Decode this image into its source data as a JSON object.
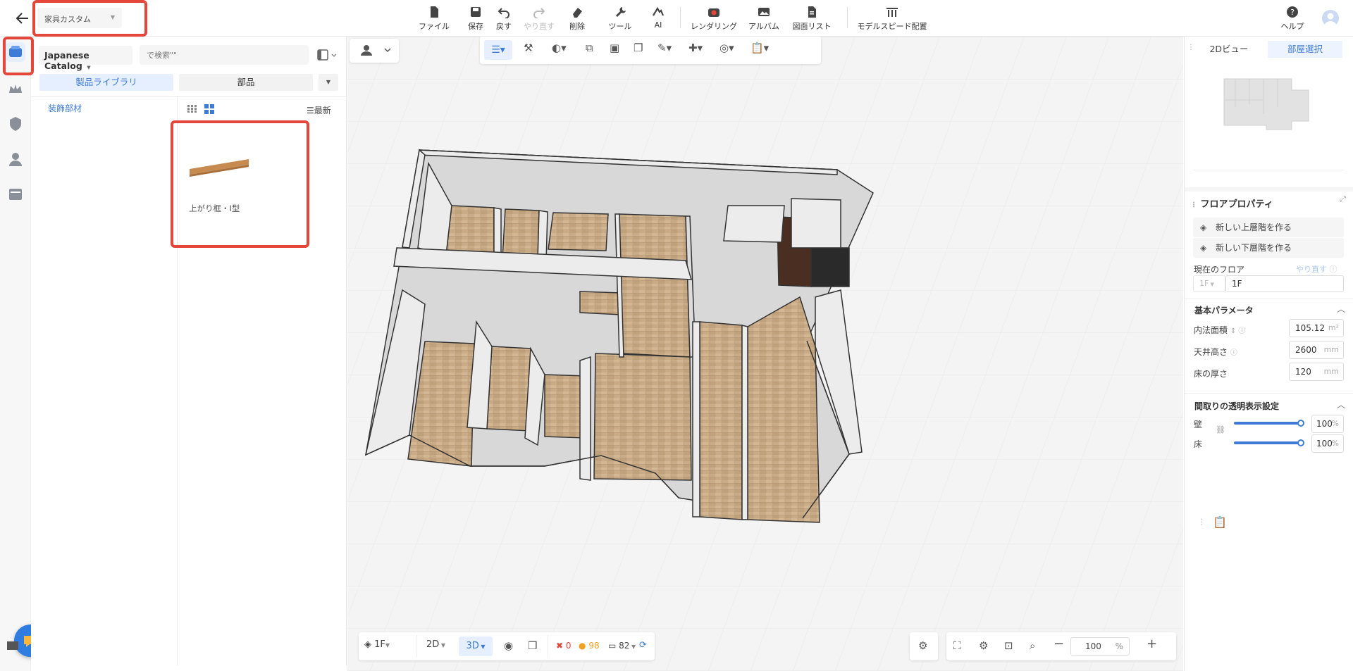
{
  "header": {
    "title_dropdown": "家具カスタム",
    "tools": [
      {
        "label": "ファイル",
        "icon": "file-icon"
      },
      {
        "label": "保存",
        "icon": "save-icon"
      },
      {
        "label": "戻す",
        "icon": "undo-icon"
      },
      {
        "label": "やり直す",
        "icon": "redo-icon"
      },
      {
        "label": "削除",
        "icon": "eraser-icon"
      },
      {
        "label": "ツール",
        "icon": "wrench-icon"
      },
      {
        "label": "AI",
        "icon": "ai-icon"
      },
      {
        "label": "レンダリング",
        "icon": "camera-icon"
      },
      {
        "label": "アルバム",
        "icon": "album-icon"
      },
      {
        "label": "図面リスト",
        "icon": "drawing-list-icon"
      },
      {
        "label": "モデルスピード配置",
        "icon": "model-speed-icon"
      }
    ],
    "help_label": "ヘルプ"
  },
  "left_panel": {
    "catalog": "Japanese Catalog",
    "search_placeholder": "で検索\"\"",
    "tab_library": "製品ライブラリ",
    "tab_parts": "部品",
    "category": "装飾部材",
    "sort_label": "最新",
    "products": [
      {
        "name": "上がり框・I型"
      }
    ]
  },
  "viewport": {
    "floor_selector": "1F",
    "mode_2d": "2D",
    "mode_3d": "3D",
    "errors": "0",
    "warnings": "98",
    "items": "82",
    "zoom": "100",
    "zoom_unit": "%"
  },
  "right_panel": {
    "tab_2d": "2Dビュー",
    "tab_room": "部屋選択",
    "floor_props_title": "フロアプロパティ",
    "btn_new_upper": "新しい上層階を作る",
    "btn_new_lower": "新しい下層階を作る",
    "current_floor_label": "現在のフロア",
    "redo_label": "やり直す",
    "floor_select": "1F",
    "floor_value": "1F",
    "basic_params_title": "基本パラメータ",
    "area_label": "内法面積",
    "area_value": "105.12",
    "area_unit": "m²",
    "ceiling_label": "天井高さ",
    "ceiling_value": "2600",
    "ceiling_unit": "mm",
    "floor_thickness_label": "床の厚さ",
    "floor_thickness_value": "120",
    "floor_thickness_unit": "mm",
    "transparency_title": "間取りの透明表示設定",
    "wall_label": "壁",
    "wall_value": "100",
    "floor_label": "床",
    "floor_trans_value": "100",
    "percent": "%"
  }
}
